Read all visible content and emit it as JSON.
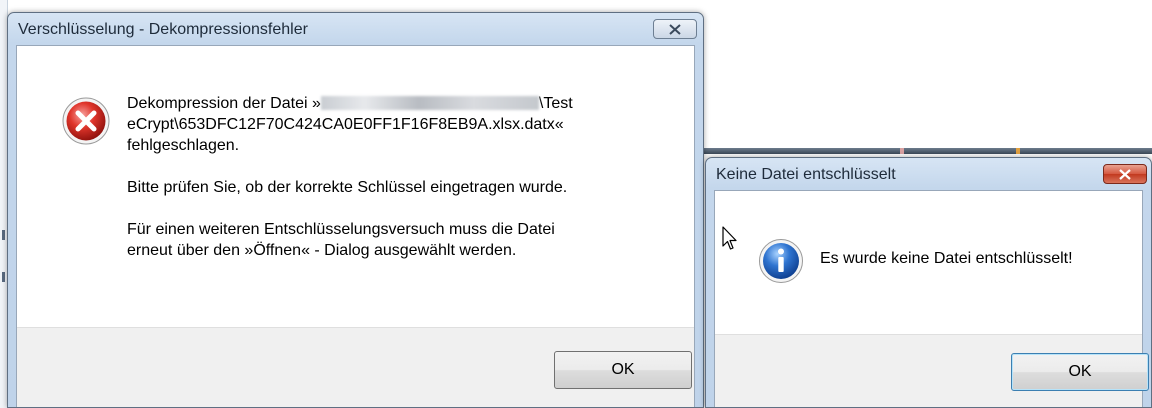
{
  "dialog_decompression": {
    "title": "Verschlüsselung - Dekompressionsfehler",
    "icon": "error-icon",
    "message_line1_prefix": "Dekompression der Datei »",
    "message_line1_suffix": "\\Test",
    "message_line2": "eCrypt\\653DFC12F70C424CA0E0FF1F16F8EB9A.xlsx.datx«",
    "message_line3": "fehlgeschlagen.",
    "paragraph2": "Bitte prüfen Sie, ob der korrekte Schlüssel eingetragen wurde.",
    "paragraph3_line1": "Für einen weiteren Entschlüsselungsversuch muss die Datei",
    "paragraph3_line2": "erneut über den »Öffnen« - Dialog ausgewählt werden.",
    "ok_label": "OK"
  },
  "dialog_no_decryption": {
    "title": "Keine Datei entschlüsselt",
    "icon": "info-icon",
    "message": "Es wurde keine Datei entschlüsselt!",
    "ok_label": "OK"
  },
  "colors": {
    "error_red": "#c8102e",
    "info_blue": "#1f5fbf",
    "close_red": "#c2391f",
    "titlebar_blue": "#c4d7ec"
  }
}
